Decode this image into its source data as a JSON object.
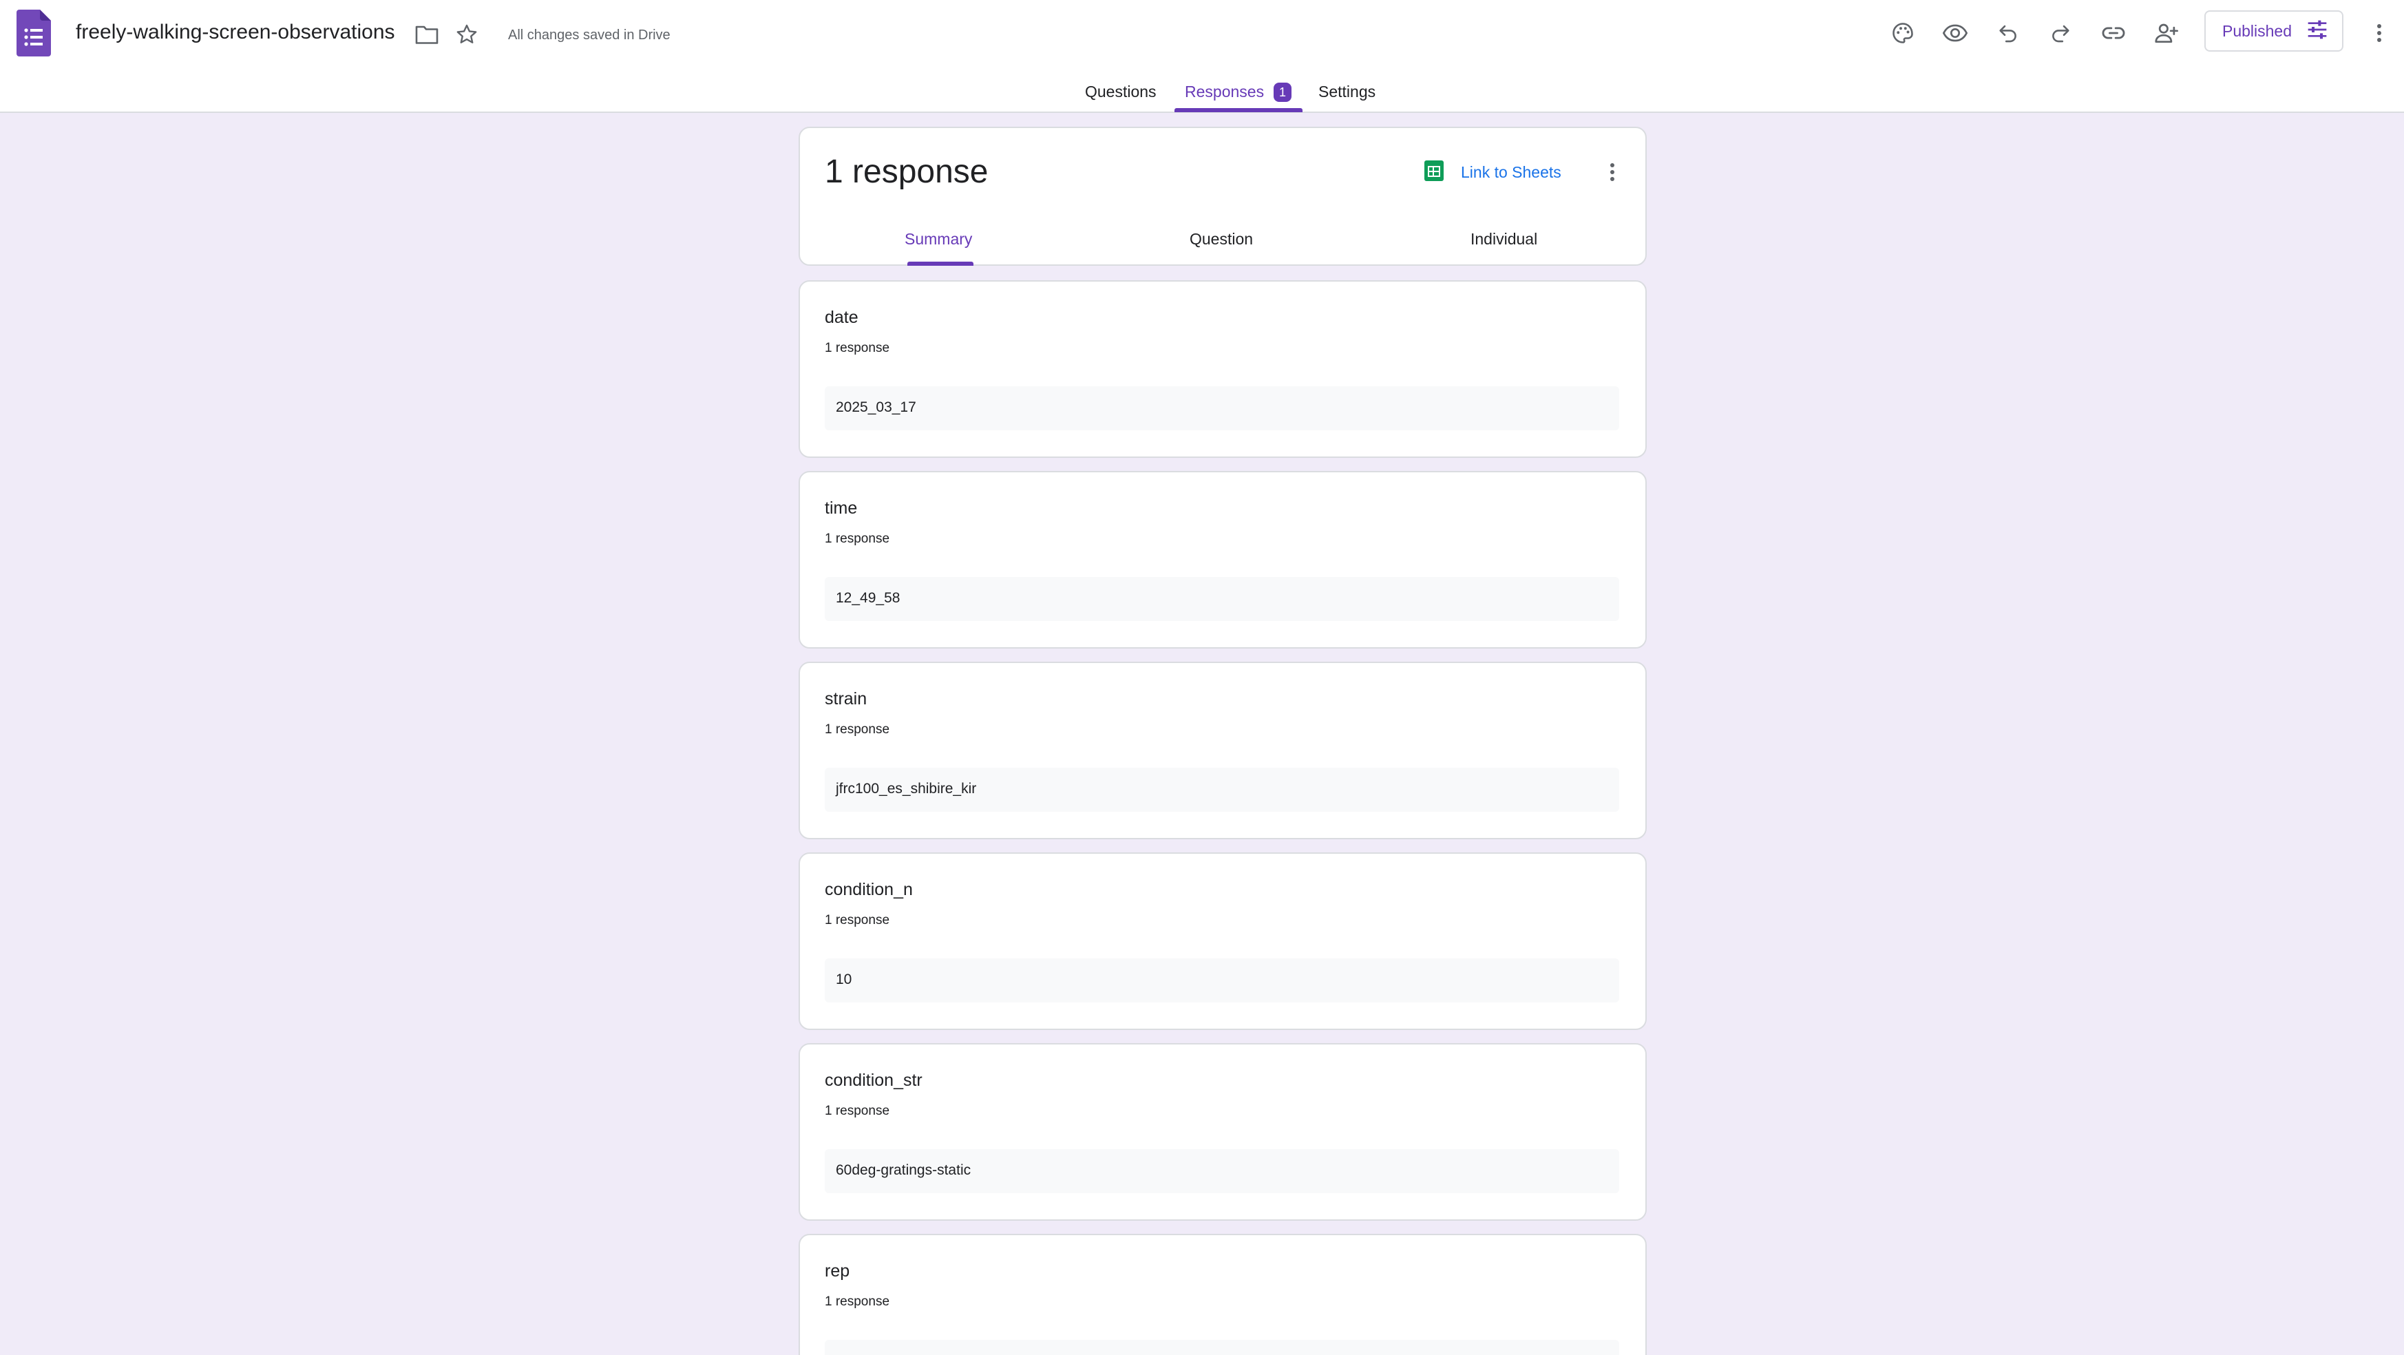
{
  "header": {
    "title": "freely-walking-screen-observations",
    "save_status": "All changes saved in Drive",
    "publish_label": "Published",
    "accent_color": "#673ab7",
    "toolbar_icons": [
      "palette-icon",
      "eye-icon",
      "undo-icon",
      "redo-icon",
      "link-icon",
      "add-person-icon",
      "tune-icon",
      "more-vert-icon"
    ]
  },
  "tabs": {
    "questions": "Questions",
    "responses": "Responses",
    "responses_badge": "1",
    "settings": "Settings",
    "active": "Responses"
  },
  "summary": {
    "count_label": "1 response",
    "link_to_sheets": "Link to Sheets",
    "subtabs": {
      "summary": "Summary",
      "question": "Question",
      "individual": "Individual",
      "active": "Summary"
    }
  },
  "questions": [
    {
      "title": "date",
      "count": "1 response",
      "answer": "2025_03_17"
    },
    {
      "title": "time",
      "count": "1 response",
      "answer": "12_49_58"
    },
    {
      "title": "strain",
      "count": "1 response",
      "answer": "jfrc100_es_shibire_kir"
    },
    {
      "title": "condition_n",
      "count": "1 response",
      "answer": "10"
    },
    {
      "title": "condition_str",
      "count": "1 response",
      "answer": "60deg-gratings-static"
    },
    {
      "title": "rep",
      "count": "1 response",
      "answer": ""
    }
  ]
}
